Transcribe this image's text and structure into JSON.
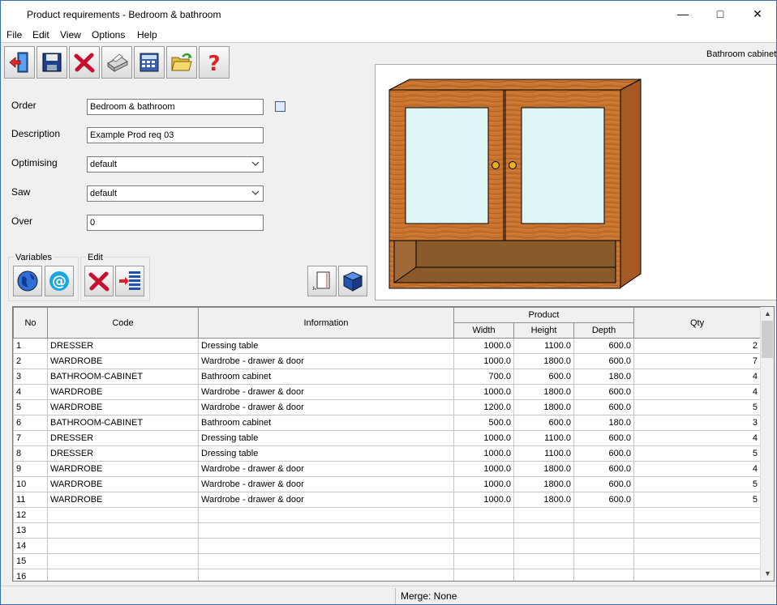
{
  "window": {
    "title": "Product requirements - Bedroom & bathroom"
  },
  "menu": [
    "File",
    "Edit",
    "View",
    "Options",
    "Help"
  ],
  "toolbar": [
    "exit-icon",
    "save-icon",
    "delete-icon",
    "print-icon",
    "calculator-icon",
    "open-folder-icon",
    "help-icon"
  ],
  "form": {
    "order_label": "Order",
    "order_value": "Bedroom & bathroom",
    "description_label": "Description",
    "description_value": "Example Prod req 03",
    "optimising_label": "Optimising",
    "optimising_value": "default",
    "saw_label": "Saw",
    "saw_value": "default",
    "over_label": "Over",
    "over_value": "0"
  },
  "groups": {
    "variables_label": "Variables",
    "edit_label": "Edit"
  },
  "preview": {
    "label": "Bathroom cabinet"
  },
  "grid": {
    "headers": {
      "no": "No",
      "code": "Code",
      "information": "Information",
      "product": "Product",
      "width": "Width",
      "height": "Height",
      "depth": "Depth",
      "qty": "Qty"
    },
    "rows": [
      {
        "no": "1",
        "code": "DRESSER",
        "information": "Dressing table",
        "width": "1000.0",
        "height": "1100.0",
        "depth": "600.0",
        "qty": "2"
      },
      {
        "no": "2",
        "code": "WARDROBE",
        "information": "Wardrobe - drawer & door",
        "width": "1000.0",
        "height": "1800.0",
        "depth": "600.0",
        "qty": "7"
      },
      {
        "no": "3",
        "code": "BATHROOM-CABINET",
        "information": "Bathroom cabinet",
        "width": "700.0",
        "height": "600.0",
        "depth": "180.0",
        "qty": "4"
      },
      {
        "no": "4",
        "code": "WARDROBE",
        "information": "Wardrobe - drawer & door",
        "width": "1000.0",
        "height": "1800.0",
        "depth": "600.0",
        "qty": "4"
      },
      {
        "no": "5",
        "code": "WARDROBE",
        "information": "Wardrobe - drawer & door",
        "width": "1200.0",
        "height": "1800.0",
        "depth": "600.0",
        "qty": "5"
      },
      {
        "no": "6",
        "code": "BATHROOM-CABINET",
        "information": "Bathroom cabinet",
        "width": "500.0",
        "height": "600.0",
        "depth": "180.0",
        "qty": "3"
      },
      {
        "no": "7",
        "code": "DRESSER",
        "information": "Dressing table",
        "width": "1000.0",
        "height": "1100.0",
        "depth": "600.0",
        "qty": "4"
      },
      {
        "no": "8",
        "code": "DRESSER",
        "information": "Dressing table",
        "width": "1000.0",
        "height": "1100.0",
        "depth": "600.0",
        "qty": "5"
      },
      {
        "no": "9",
        "code": "WARDROBE",
        "information": "Wardrobe - drawer & door",
        "width": "1000.0",
        "height": "1800.0",
        "depth": "600.0",
        "qty": "4"
      },
      {
        "no": "10",
        "code": "WARDROBE",
        "information": "Wardrobe - drawer & door",
        "width": "1000.0",
        "height": "1800.0",
        "depth": "600.0",
        "qty": "5"
      },
      {
        "no": "11",
        "code": "WARDROBE",
        "information": "Wardrobe - drawer & door",
        "width": "1000.0",
        "height": "1800.0",
        "depth": "600.0",
        "qty": "5"
      },
      {
        "no": "12",
        "code": "",
        "information": "",
        "width": "",
        "height": "",
        "depth": "",
        "qty": ""
      },
      {
        "no": "13",
        "code": "",
        "information": "",
        "width": "",
        "height": "",
        "depth": "",
        "qty": ""
      },
      {
        "no": "14",
        "code": "",
        "information": "",
        "width": "",
        "height": "",
        "depth": "",
        "qty": ""
      },
      {
        "no": "15",
        "code": "",
        "information": "",
        "width": "",
        "height": "",
        "depth": "",
        "qty": ""
      },
      {
        "no": "16",
        "code": "",
        "information": "",
        "width": "",
        "height": "",
        "depth": "",
        "qty": ""
      }
    ]
  },
  "status": {
    "merge": "Merge: None"
  }
}
